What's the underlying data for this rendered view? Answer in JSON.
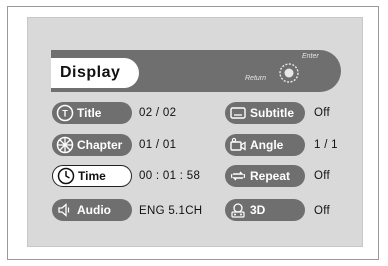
{
  "header": {
    "title": "Display",
    "enter_label": "Enter",
    "return_label": "Return"
  },
  "rows": [
    {
      "label": "Title",
      "value": "02 / 02",
      "icon": "title-icon"
    },
    {
      "label": "Chapter",
      "value": "01 / 01",
      "icon": "chapter-icon"
    },
    {
      "label": "Time",
      "value": "00 : 01 : 58",
      "icon": "clock-icon",
      "active": true
    },
    {
      "label": "Audio",
      "value": "ENG 5.1CH",
      "icon": "speaker-icon"
    },
    {
      "label": "Subtitle",
      "value": "Off",
      "icon": "subtitle-icon"
    },
    {
      "label": "Angle",
      "value": "1 / 1",
      "icon": "camera-angle-icon"
    },
    {
      "label": "Repeat",
      "value": "Off",
      "icon": "repeat-icon"
    },
    {
      "label": "3D",
      "value": "Off",
      "icon": "3d-sound-icon"
    }
  ]
}
